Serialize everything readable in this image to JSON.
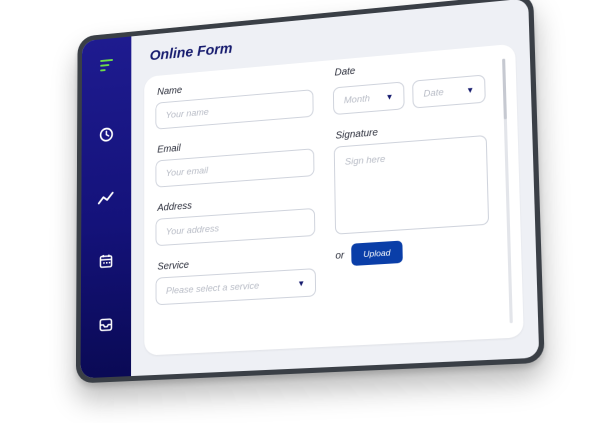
{
  "app": {
    "title": "Online Form"
  },
  "sidebar": {
    "items": [
      {
        "name": "menu-icon"
      },
      {
        "name": "clock-icon"
      },
      {
        "name": "trend-icon"
      },
      {
        "name": "calendar-icon"
      },
      {
        "name": "inbox-icon"
      }
    ],
    "accent": "#6fdc4a",
    "background": "#14127a"
  },
  "form": {
    "name": {
      "label": "Name",
      "placeholder": "Your name"
    },
    "email": {
      "label": "Email",
      "placeholder": "Your email"
    },
    "address": {
      "label": "Address",
      "placeholder": "Your address"
    },
    "service": {
      "label": "Service",
      "placeholder": "Please select a service"
    },
    "date": {
      "label": "Date",
      "month_placeholder": "Month",
      "day_placeholder": "Date"
    },
    "signature": {
      "label": "Signature",
      "placeholder": "Sign here"
    },
    "or_text": "or",
    "upload_label": "Upload"
  },
  "colors": {
    "title": "#161b6e",
    "button": "#0a3ea8"
  }
}
